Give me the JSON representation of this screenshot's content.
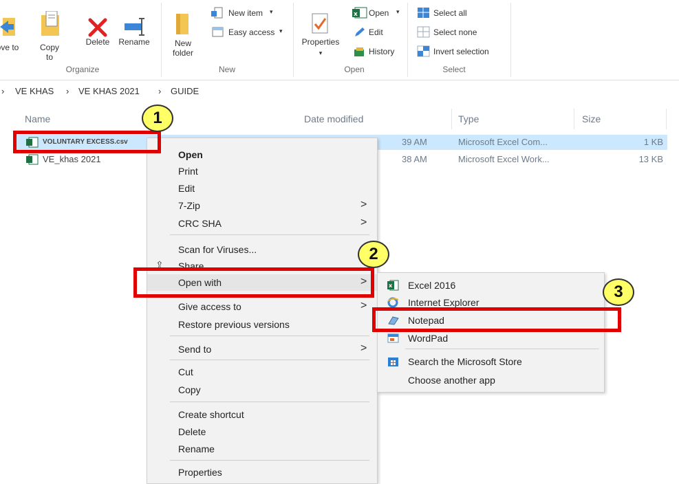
{
  "ribbon": {
    "move_to": "Move to",
    "copy_to": "Copy to",
    "delete": "Delete",
    "rename": "Rename",
    "organize": "Organize",
    "new_folder": "New folder",
    "new_item": "New item",
    "easy_access": "Easy access",
    "new": "New",
    "properties": "Properties",
    "open": "Open",
    "edit": "Edit",
    "history": "History",
    "open_group": "Open",
    "select_all": "Select all",
    "select_none": "Select none",
    "invert_selection": "Invert selection",
    "select_group": "Select"
  },
  "breadcrumb": {
    "separator": "›",
    "items": [
      "VE KHAS",
      "VE KHAS 2021",
      "GUIDE"
    ]
  },
  "columns": {
    "name": "Name",
    "date": "Date modified",
    "type": "Type",
    "size": "Size"
  },
  "files": [
    {
      "name": "VOLUNTARY EXCESS.csv",
      "date": "39 AM",
      "type": "Microsoft Excel Com...",
      "size": "1 KB"
    },
    {
      "name": "VE_khas 2021",
      "date": "38 AM",
      "type": "Microsoft Excel Work...",
      "size": "13 KB"
    }
  ],
  "context_menu": {
    "open": "Open",
    "print": "Print",
    "edit": "Edit",
    "zip": "7-Zip",
    "crc": "CRC SHA",
    "scan": "Scan for Viruses...",
    "share": "Share",
    "open_with": "Open with",
    "give_access": "Give access to",
    "restore": "Restore previous versions",
    "send_to": "Send to",
    "cut": "Cut",
    "copy": "Copy",
    "create_shortcut": "Create shortcut",
    "delete": "Delete",
    "rename": "Rename",
    "properties": "Properties"
  },
  "submenu": {
    "excel": "Excel 2016",
    "ie": "Internet Explorer",
    "notepad": "Notepad",
    "wordpad": "WordPad",
    "store": "Search the Microsoft Store",
    "choose": "Choose another app"
  },
  "annotations": {
    "step1": "1",
    "step2": "2",
    "step3": "3"
  },
  "colors": {
    "annotation_red": "#e00000",
    "badge_yellow": "#ffff66",
    "selection_blue": "#cce8ff"
  }
}
